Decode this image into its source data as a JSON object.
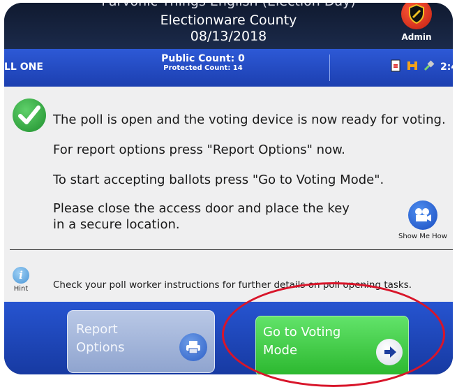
{
  "header": {
    "partial_line": "Parvonic Things English (Election Day)",
    "county": "Electionware County",
    "date": "08/13/2018",
    "admin_label": "Admin"
  },
  "status_bar": {
    "poll_name": "LL ONE",
    "public_count": "Public Count: 0",
    "protected_count": "Protected Count: 14",
    "time": "2:4"
  },
  "messages": {
    "line1": "The poll is open and the voting device is now ready for voting.",
    "line2": "For report options press \"Report Options\" now.",
    "line3": "To start accepting ballots press \"Go to Voting Mode\".",
    "line4a": "Please close the access door and place the key",
    "line4b": "in a secure location."
  },
  "show_me_how": {
    "label": "Show Me How"
  },
  "hint": {
    "label": "Hint",
    "glyph": "i",
    "text": "Check your poll worker instructions for further details on poll opening tasks."
  },
  "buttons": {
    "report_options": {
      "line1": "Report",
      "line2": "Options"
    },
    "go_to_voting": {
      "line1": "Go to Voting",
      "line2": "Mode"
    }
  },
  "colors": {
    "status_bar": "#2d59d6",
    "vote_button": "#3cc83f",
    "highlight_ellipse": "#d8152a"
  }
}
